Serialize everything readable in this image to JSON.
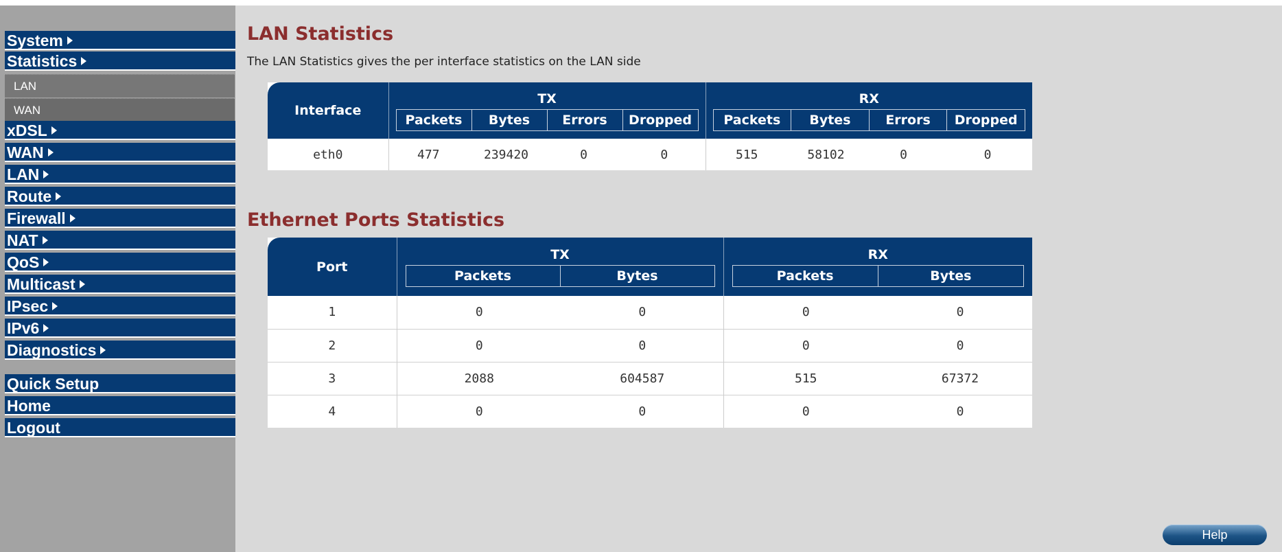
{
  "sidebar": {
    "top_menu": [
      {
        "label": "System"
      },
      {
        "label": "Statistics"
      }
    ],
    "sub_items": [
      {
        "label": "LAN"
      },
      {
        "label": "WAN"
      }
    ],
    "menu": [
      {
        "label": "xDSL"
      },
      {
        "label": "WAN"
      },
      {
        "label": "LAN"
      },
      {
        "label": "Route"
      },
      {
        "label": "Firewall"
      },
      {
        "label": "NAT"
      },
      {
        "label": "QoS"
      },
      {
        "label": "Multicast"
      },
      {
        "label": "IPsec"
      },
      {
        "label": "IPv6"
      },
      {
        "label": "Diagnostics"
      }
    ],
    "bottom_menu": [
      {
        "label": "Quick Setup"
      },
      {
        "label": "Home"
      },
      {
        "label": "Logout"
      }
    ]
  },
  "lan_stats": {
    "title": "LAN Statistics",
    "description": "The LAN Statistics gives the per interface statistics on the LAN side",
    "headers": {
      "interface": "Interface",
      "tx": "TX",
      "rx": "RX",
      "packets": "Packets",
      "bytes": "Bytes",
      "errors": "Errors",
      "dropped": "Dropped"
    },
    "rows": [
      {
        "interface": "eth0",
        "tx_packets": "477",
        "tx_bytes": "239420",
        "tx_errors": "0",
        "tx_dropped": "0",
        "rx_packets": "515",
        "rx_bytes": "58102",
        "rx_errors": "0",
        "rx_dropped": "0"
      }
    ]
  },
  "eth_stats": {
    "title": "Ethernet Ports Statistics",
    "headers": {
      "port": "Port",
      "tx": "TX",
      "rx": "RX",
      "packets": "Packets",
      "bytes": "Bytes"
    },
    "rows": [
      {
        "port": "1",
        "tx_packets": "0",
        "tx_bytes": "0",
        "rx_packets": "0",
        "rx_bytes": "0"
      },
      {
        "port": "2",
        "tx_packets": "0",
        "tx_bytes": "0",
        "rx_packets": "0",
        "rx_bytes": "0"
      },
      {
        "port": "3",
        "tx_packets": "2088",
        "tx_bytes": "604587",
        "rx_packets": "515",
        "rx_bytes": "67372"
      },
      {
        "port": "4",
        "tx_packets": "0",
        "tx_bytes": "0",
        "rx_packets": "0",
        "rx_bytes": "0"
      }
    ]
  },
  "help_button": {
    "label": "Help"
  },
  "colors": {
    "nav_blue": "#063a73",
    "title_red": "#8b2e2e",
    "sidebar_gray": "#a3a3a3",
    "content_gray": "#d9d9d9"
  }
}
